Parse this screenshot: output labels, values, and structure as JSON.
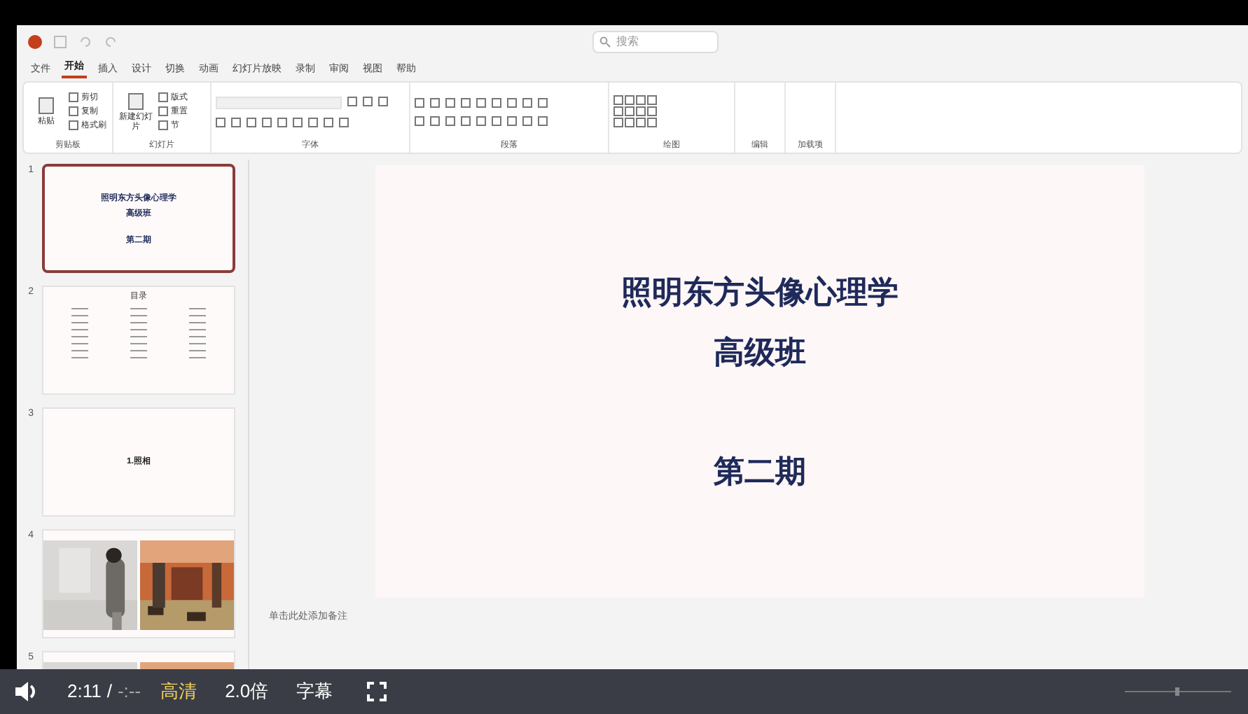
{
  "search": {
    "placeholder": "搜索"
  },
  "ribbon_tabs": [
    {
      "label": "文件",
      "selected": false
    },
    {
      "label": "开始",
      "selected": true
    },
    {
      "label": "插入",
      "selected": false
    },
    {
      "label": "设计",
      "selected": false
    },
    {
      "label": "切换",
      "selected": false
    },
    {
      "label": "动画",
      "selected": false
    },
    {
      "label": "幻灯片放映",
      "selected": false
    },
    {
      "label": "录制",
      "selected": false
    },
    {
      "label": "审阅",
      "selected": false
    },
    {
      "label": "视图",
      "selected": false
    },
    {
      "label": "帮助",
      "selected": false
    }
  ],
  "ribbon_groups": [
    {
      "label": "剪贴板",
      "kind": "clipboard",
      "buttons": [
        "粘贴",
        "剪切",
        "复制",
        "格式刷"
      ]
    },
    {
      "label": "幻灯片",
      "kind": "slides",
      "buttons": [
        "新建幻灯片",
        "版式",
        "重置",
        "节"
      ]
    },
    {
      "label": "字体",
      "kind": "font"
    },
    {
      "label": "段落",
      "kind": "paragraph"
    },
    {
      "label": "绘图",
      "kind": "drawing"
    },
    {
      "label": "编辑",
      "kind": "plain"
    },
    {
      "label": "加载项",
      "kind": "plain"
    }
  ],
  "slides": [
    {
      "number": "1",
      "selected": true,
      "kind": "title",
      "lines": [
        "照明东方头像心理学",
        "高级班",
        "第二期"
      ]
    },
    {
      "number": "2",
      "selected": false,
      "kind": "toc",
      "lines": [
        "目录"
      ]
    },
    {
      "number": "3",
      "selected": false,
      "kind": "section",
      "lines": [
        "1.照相"
      ]
    },
    {
      "number": "4",
      "selected": false,
      "kind": "photos"
    },
    {
      "number": "5",
      "selected": false,
      "kind": "photos"
    }
  ],
  "main_slide": {
    "lines": [
      "照明东方头像心理学",
      "高级班",
      "第二期"
    ]
  },
  "notes": {
    "placeholder": "单击此处添加备注"
  },
  "player": {
    "time": "2:11",
    "separator": "/",
    "duration": "-:--",
    "quality": "高清",
    "speed": "2.0倍",
    "subtitles": "字幕"
  }
}
